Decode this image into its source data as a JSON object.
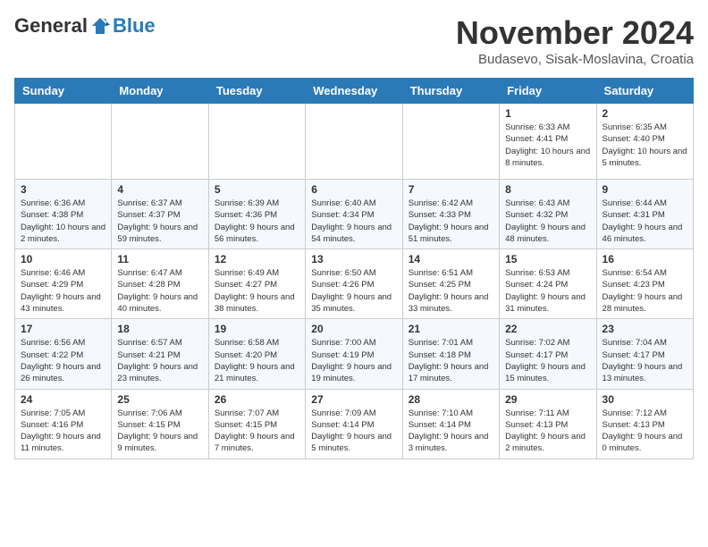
{
  "logo": {
    "general": "General",
    "blue": "Blue"
  },
  "title": "November 2024",
  "subtitle": "Budasevo, Sisak-Moslavina, Croatia",
  "days_of_week": [
    "Sunday",
    "Monday",
    "Tuesday",
    "Wednesday",
    "Thursday",
    "Friday",
    "Saturday"
  ],
  "weeks": [
    [
      {
        "day": "",
        "info": ""
      },
      {
        "day": "",
        "info": ""
      },
      {
        "day": "",
        "info": ""
      },
      {
        "day": "",
        "info": ""
      },
      {
        "day": "",
        "info": ""
      },
      {
        "day": "1",
        "info": "Sunrise: 6:33 AM\nSunset: 4:41 PM\nDaylight: 10 hours and 8 minutes."
      },
      {
        "day": "2",
        "info": "Sunrise: 6:35 AM\nSunset: 4:40 PM\nDaylight: 10 hours and 5 minutes."
      }
    ],
    [
      {
        "day": "3",
        "info": "Sunrise: 6:36 AM\nSunset: 4:38 PM\nDaylight: 10 hours and 2 minutes."
      },
      {
        "day": "4",
        "info": "Sunrise: 6:37 AM\nSunset: 4:37 PM\nDaylight: 9 hours and 59 minutes."
      },
      {
        "day": "5",
        "info": "Sunrise: 6:39 AM\nSunset: 4:36 PM\nDaylight: 9 hours and 56 minutes."
      },
      {
        "day": "6",
        "info": "Sunrise: 6:40 AM\nSunset: 4:34 PM\nDaylight: 9 hours and 54 minutes."
      },
      {
        "day": "7",
        "info": "Sunrise: 6:42 AM\nSunset: 4:33 PM\nDaylight: 9 hours and 51 minutes."
      },
      {
        "day": "8",
        "info": "Sunrise: 6:43 AM\nSunset: 4:32 PM\nDaylight: 9 hours and 48 minutes."
      },
      {
        "day": "9",
        "info": "Sunrise: 6:44 AM\nSunset: 4:31 PM\nDaylight: 9 hours and 46 minutes."
      }
    ],
    [
      {
        "day": "10",
        "info": "Sunrise: 6:46 AM\nSunset: 4:29 PM\nDaylight: 9 hours and 43 minutes."
      },
      {
        "day": "11",
        "info": "Sunrise: 6:47 AM\nSunset: 4:28 PM\nDaylight: 9 hours and 40 minutes."
      },
      {
        "day": "12",
        "info": "Sunrise: 6:49 AM\nSunset: 4:27 PM\nDaylight: 9 hours and 38 minutes."
      },
      {
        "day": "13",
        "info": "Sunrise: 6:50 AM\nSunset: 4:26 PM\nDaylight: 9 hours and 35 minutes."
      },
      {
        "day": "14",
        "info": "Sunrise: 6:51 AM\nSunset: 4:25 PM\nDaylight: 9 hours and 33 minutes."
      },
      {
        "day": "15",
        "info": "Sunrise: 6:53 AM\nSunset: 4:24 PM\nDaylight: 9 hours and 31 minutes."
      },
      {
        "day": "16",
        "info": "Sunrise: 6:54 AM\nSunset: 4:23 PM\nDaylight: 9 hours and 28 minutes."
      }
    ],
    [
      {
        "day": "17",
        "info": "Sunrise: 6:56 AM\nSunset: 4:22 PM\nDaylight: 9 hours and 26 minutes."
      },
      {
        "day": "18",
        "info": "Sunrise: 6:57 AM\nSunset: 4:21 PM\nDaylight: 9 hours and 23 minutes."
      },
      {
        "day": "19",
        "info": "Sunrise: 6:58 AM\nSunset: 4:20 PM\nDaylight: 9 hours and 21 minutes."
      },
      {
        "day": "20",
        "info": "Sunrise: 7:00 AM\nSunset: 4:19 PM\nDaylight: 9 hours and 19 minutes."
      },
      {
        "day": "21",
        "info": "Sunrise: 7:01 AM\nSunset: 4:18 PM\nDaylight: 9 hours and 17 minutes."
      },
      {
        "day": "22",
        "info": "Sunrise: 7:02 AM\nSunset: 4:17 PM\nDaylight: 9 hours and 15 minutes."
      },
      {
        "day": "23",
        "info": "Sunrise: 7:04 AM\nSunset: 4:17 PM\nDaylight: 9 hours and 13 minutes."
      }
    ],
    [
      {
        "day": "24",
        "info": "Sunrise: 7:05 AM\nSunset: 4:16 PM\nDaylight: 9 hours and 11 minutes."
      },
      {
        "day": "25",
        "info": "Sunrise: 7:06 AM\nSunset: 4:15 PM\nDaylight: 9 hours and 9 minutes."
      },
      {
        "day": "26",
        "info": "Sunrise: 7:07 AM\nSunset: 4:15 PM\nDaylight: 9 hours and 7 minutes."
      },
      {
        "day": "27",
        "info": "Sunrise: 7:09 AM\nSunset: 4:14 PM\nDaylight: 9 hours and 5 minutes."
      },
      {
        "day": "28",
        "info": "Sunrise: 7:10 AM\nSunset: 4:14 PM\nDaylight: 9 hours and 3 minutes."
      },
      {
        "day": "29",
        "info": "Sunrise: 7:11 AM\nSunset: 4:13 PM\nDaylight: 9 hours and 2 minutes."
      },
      {
        "day": "30",
        "info": "Sunrise: 7:12 AM\nSunset: 4:13 PM\nDaylight: 9 hours and 0 minutes."
      }
    ]
  ]
}
